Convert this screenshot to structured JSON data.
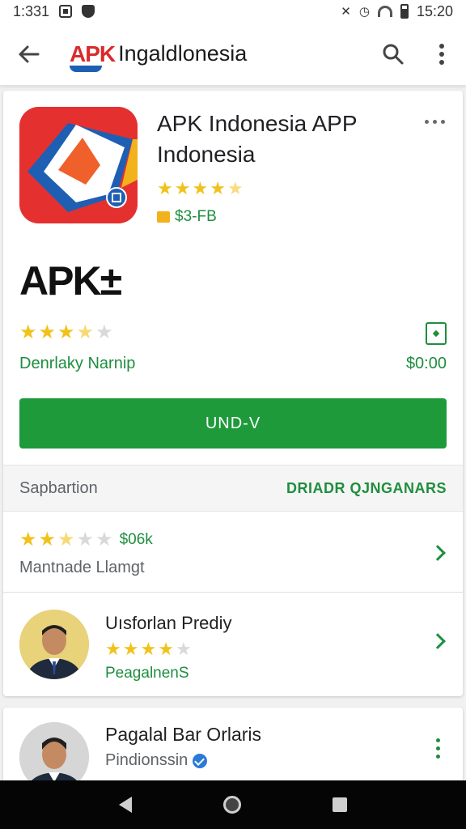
{
  "status_bar": {
    "time": "1:331",
    "clock_right": "15:20"
  },
  "toolbar": {
    "logo_mark": "APK",
    "logo_text": "Ingaldlonesia",
    "back_icon": "arrow-left-icon",
    "search_icon": "search-icon",
    "menu_icon": "more-vertical-icon"
  },
  "app": {
    "title": "APK Indonesia APP Indonesia",
    "rating_stars": 4.5,
    "price": "$3-FB",
    "big_title": "APK±",
    "second_rating_stars": 3.5,
    "developer": "Denrlaky Narnip",
    "price_right": "$0:00",
    "install_label": "UND-V"
  },
  "section": {
    "title": "Sapbartion",
    "link": "DRIADR QJNGANARS"
  },
  "rating_row": {
    "stars": 2.5,
    "count": "$06k",
    "subtitle": "Mantnade Llamgt"
  },
  "reviewer": {
    "name": "Uısforlan Prediy",
    "stars": 4,
    "subtitle": "PeagalnenS"
  },
  "second_card": {
    "name": "Pagalal Bar Orlaris",
    "subtitle": "Pindionssin"
  },
  "colors": {
    "accent_green": "#1e9a3a",
    "brand_red": "#e53030",
    "brand_blue": "#1e5fb4",
    "star": "#f2c21c"
  }
}
